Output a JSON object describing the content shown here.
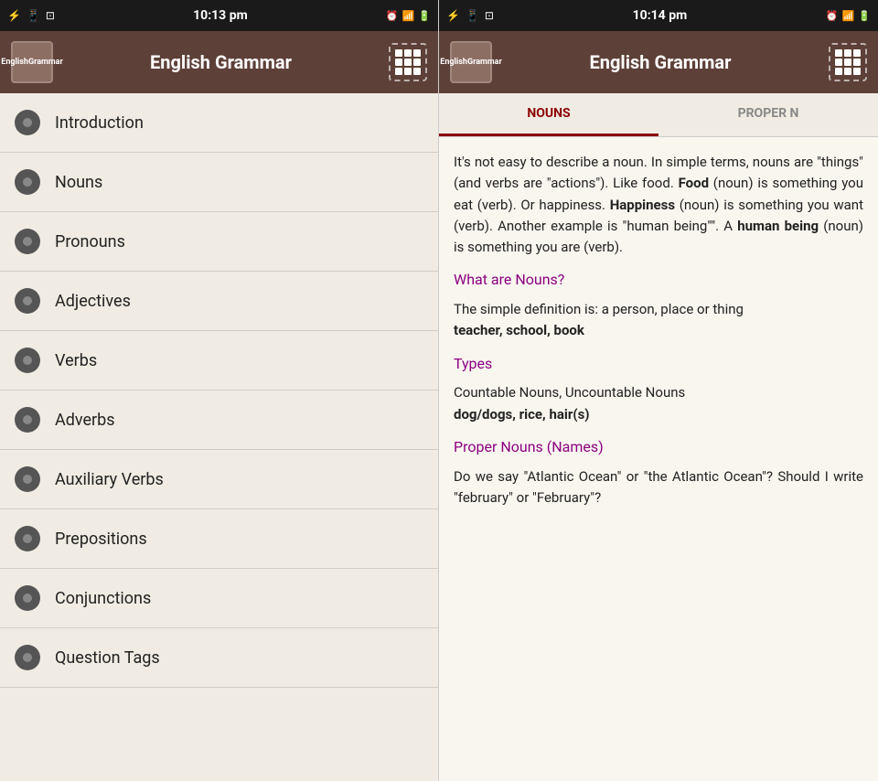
{
  "left": {
    "statusBar": {
      "time": "10:13 pm",
      "leftIcons": [
        "usb-icon",
        "phone-icon",
        "tablet-icon"
      ]
    },
    "appBar": {
      "appIconLine1": "English",
      "appIconLine2": "Grammar",
      "title": "English Grammar",
      "gridBtn": "grid-button"
    },
    "navItems": [
      {
        "label": "Introduction"
      },
      {
        "label": "Nouns"
      },
      {
        "label": "Pronouns"
      },
      {
        "label": "Adjectives"
      },
      {
        "label": "Verbs"
      },
      {
        "label": "Adverbs"
      },
      {
        "label": "Auxiliary Verbs"
      },
      {
        "label": "Prepositions"
      },
      {
        "label": "Conjunctions"
      },
      {
        "label": "Question Tags"
      }
    ]
  },
  "right": {
    "statusBar": {
      "time": "10:14 pm"
    },
    "appBar": {
      "appIconLine1": "English",
      "appIconLine2": "Grammar",
      "title": "English Grammar"
    },
    "tabs": [
      {
        "label": "NOUNS",
        "active": true
      },
      {
        "label": "PROPER N",
        "active": false
      }
    ],
    "content": {
      "intro": "It's not easy to describe a noun. In simple terms, nouns are \"things\" (and verbs are \"actions\"). Like food. Food (noun) is something you eat (verb). Or happiness. Happiness (noun) is something you want (verb). Another example is \"human being\"\". A human being (noun) is something you are (verb).",
      "link1": "What are Nouns?",
      "simpleDef": "The simple definition is: a person, place or thing",
      "examples1": "teacher, school, book",
      "link2": "Types",
      "types": "Countable Nouns, Uncountable Nouns",
      "examples2": "dog/dogs, rice, hair(s)",
      "link3": "Proper Nouns (Names)",
      "properDef": "Do we say \"Atlantic Ocean\" or \"the Atlantic Ocean\"? Should I write \"february\" or \"February\"?"
    }
  }
}
